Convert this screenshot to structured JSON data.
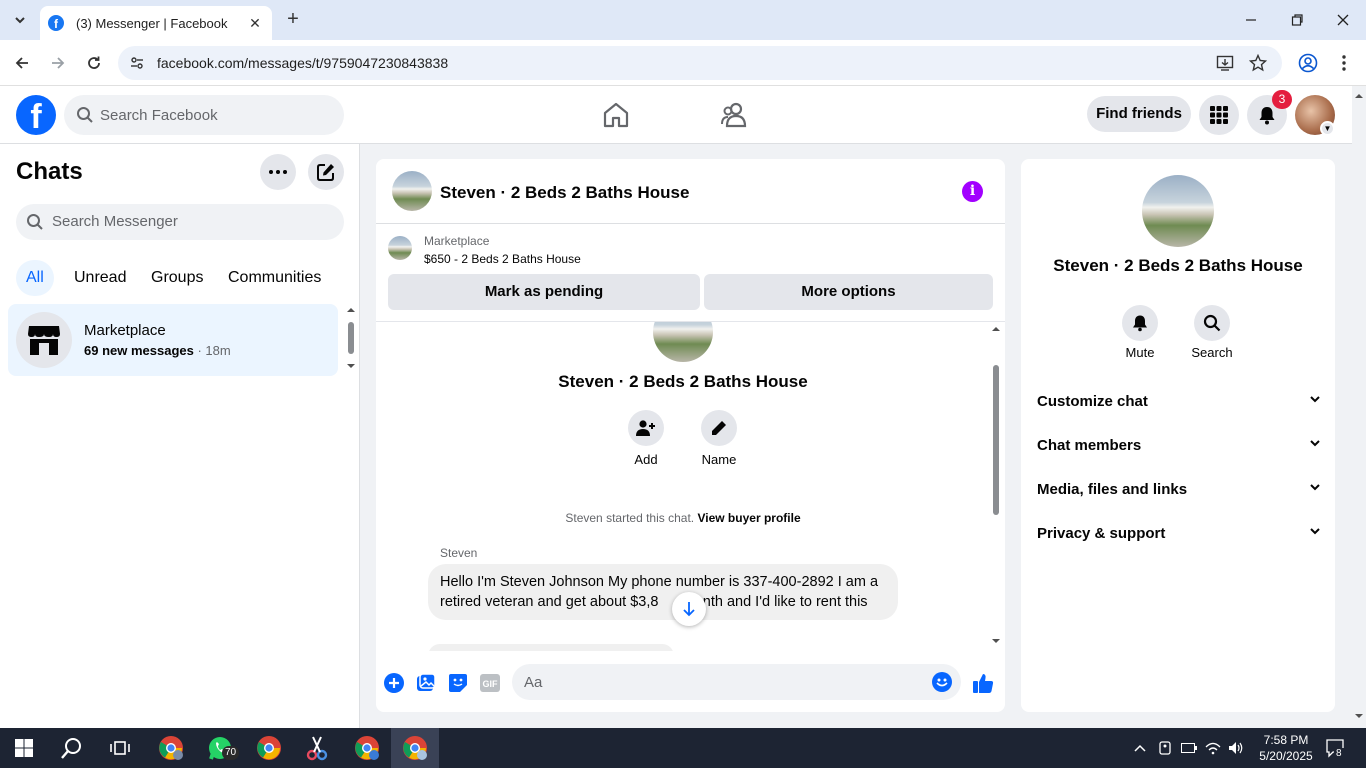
{
  "browser": {
    "tab_title": "(3) Messenger | Facebook",
    "url": "facebook.com/messages/t/9759047230843838"
  },
  "fb": {
    "search_placeholder": "Search Facebook",
    "find_friends": "Find friends",
    "notif_count": "3"
  },
  "chats": {
    "title": "Chats",
    "search_placeholder": "Search Messenger",
    "filters": [
      "All",
      "Unread",
      "Groups",
      "Communities"
    ],
    "items": [
      {
        "name": "Marketplace",
        "preview": "69 new messages",
        "time": " · 18m"
      }
    ]
  },
  "conversation": {
    "title": "Steven · 2 Beds 2 Baths House",
    "marketplace_label": "Marketplace",
    "listing": "$650 - 2 Beds 2 Baths House",
    "mark_pending": "Mark as pending",
    "more_options": "More options",
    "profile_name": "Steven · 2 Beds 2 Baths House",
    "add_label": "Add",
    "name_label": "Name",
    "started_text": "Steven started this chat.",
    "view_profile": "View buyer profile",
    "sender": "Steven",
    "message": "Hello I'm Steven Johnson My phone number is 337-400-2892 I am a retired veteran and get about $3,8      month and I'd like to rent this",
    "composer_placeholder": "Aa"
  },
  "details": {
    "name": "Steven · 2 Beds 2 Baths House",
    "mute": "Mute",
    "search": "Search",
    "sections": [
      "Customize chat",
      "Chat members",
      "Media, files and links",
      "Privacy & support"
    ]
  },
  "taskbar": {
    "whatsapp_badge": "70",
    "time": "7:58 PM",
    "date": "5/20/2025",
    "notifications": "8"
  },
  "colors": {
    "accent": "#0866ff",
    "messenger_purple": "#a200ff",
    "badge_red": "#e41e3f"
  }
}
